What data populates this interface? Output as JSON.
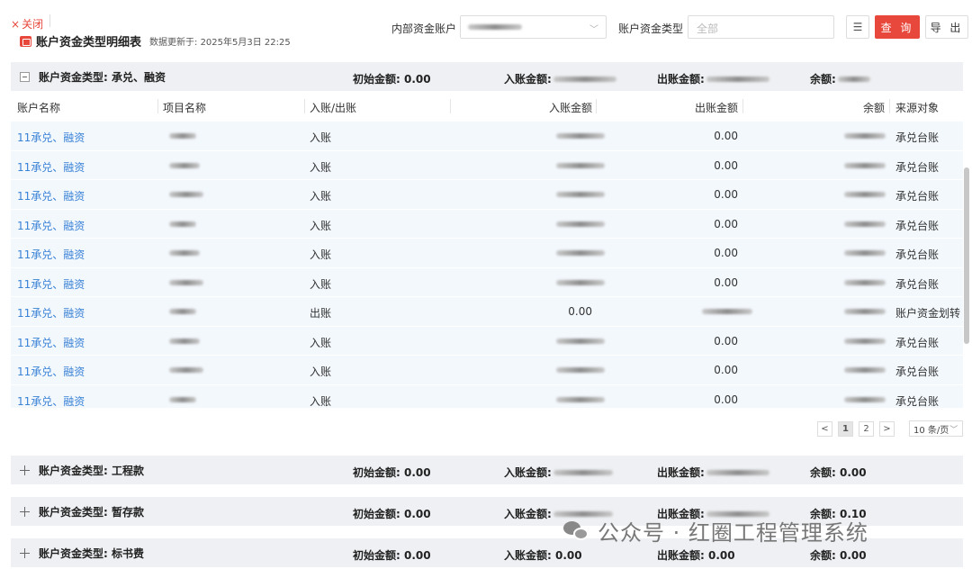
{
  "header": {
    "close_label": "关闭",
    "title": "账户资金类型明细表",
    "update_label": "数据更新于: 2025年5月3日 22:25"
  },
  "filters": {
    "account_label": "内部资金账户",
    "type_label": "账户资金类型",
    "type_placeholder": "全部",
    "query_label": "查 询",
    "export_label": "导 出",
    "columns_icon": "column-settings-icon"
  },
  "groups": [
    {
      "label": "账户资金类型: 承兑、融资",
      "initial_label": "初始金额: 0.00",
      "in_label": "入账金额:",
      "out_label": "出账金额:",
      "balance_label": "余额:"
    },
    {
      "label": "账户资金类型: 工程款",
      "initial_label": "初始金额: 0.00",
      "in_label": "入账金额:",
      "out_label": "出账金额:",
      "balance_label": "余额: 0.00"
    },
    {
      "label": "账户资金类型: 暂存款",
      "initial_label": "初始金额: 0.00",
      "in_label": "入账金额:",
      "out_label": "出账金额:",
      "balance_label": "余额: 0.10"
    },
    {
      "label": "账户资金类型: 标书费",
      "initial_label": "初始金额: 0.00",
      "in_label": "入账金额: 0.00",
      "out_label": "出账金额: 0.00",
      "balance_label": "余额: 0.00"
    }
  ],
  "table": {
    "columns": [
      "账户名称",
      "项目名称",
      "入账/出账",
      "入账金额",
      "出账金额",
      "余额",
      "来源对象"
    ],
    "rows": [
      {
        "account": "11承兑、融资",
        "direction": "入账",
        "in_amount": "",
        "out_amount": "0.00",
        "source": "承兑台账"
      },
      {
        "account": "11承兑、融资",
        "direction": "入账",
        "in_amount": "",
        "out_amount": "0.00",
        "source": "承兑台账"
      },
      {
        "account": "11承兑、融资",
        "direction": "入账",
        "in_amount": "",
        "out_amount": "0.00",
        "source": "承兑台账"
      },
      {
        "account": "11承兑、融资",
        "direction": "入账",
        "in_amount": "",
        "out_amount": "0.00",
        "source": "承兑台账"
      },
      {
        "account": "11承兑、融资",
        "direction": "入账",
        "in_amount": "",
        "out_amount": "0.00",
        "source": "承兑台账"
      },
      {
        "account": "11承兑、融资",
        "direction": "入账",
        "in_amount": "",
        "out_amount": "0.00",
        "source": "承兑台账"
      },
      {
        "account": "11承兑、融资",
        "direction": "出账",
        "in_amount": "0.00",
        "out_amount": "",
        "source": "账户资金划转"
      },
      {
        "account": "11承兑、融资",
        "direction": "入账",
        "in_amount": "",
        "out_amount": "0.00",
        "source": "承兑台账"
      },
      {
        "account": "11承兑、融资",
        "direction": "入账",
        "in_amount": "",
        "out_amount": "0.00",
        "source": "承兑台账"
      },
      {
        "account": "11承兑、融资",
        "direction": "入账",
        "in_amount": "",
        "out_amount": "0.00",
        "source": "承兑台账"
      }
    ]
  },
  "pagination": {
    "prev": "<",
    "pages": [
      "1",
      "2"
    ],
    "current": "1",
    "next": ">",
    "page_size": "10 条/页"
  },
  "watermark": {
    "text": "公众号 · 红圈工程管理系统"
  }
}
